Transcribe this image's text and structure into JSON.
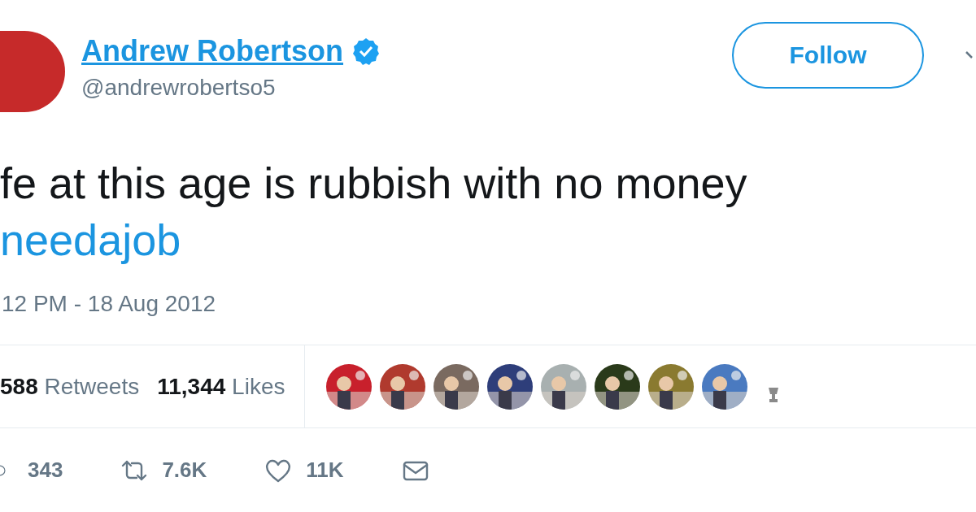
{
  "author": {
    "name": "Andrew Robertson",
    "verified": true,
    "handle": "@andrewrobertso5"
  },
  "follow_button": {
    "label": "Follow"
  },
  "tweet": {
    "lines": [
      "fe at this age is rubbish with no money"
    ],
    "hashtag": "needajob",
    "timestamp": "12 PM - 18 Aug 2012"
  },
  "stats": [
    {
      "count": "588",
      "label": "Retweets"
    },
    {
      "count": "11,344",
      "label": "Likes"
    }
  ],
  "likers": [
    {
      "kind": "picture"
    },
    {
      "kind": "picture"
    },
    {
      "kind": "picture"
    },
    {
      "kind": "picture"
    },
    {
      "kind": "picture"
    },
    {
      "kind": "picture"
    },
    {
      "kind": "picture"
    },
    {
      "kind": "picture"
    },
    {
      "kind": "small"
    }
  ],
  "actions": [
    {
      "kind": "reply",
      "count": "343"
    },
    {
      "kind": "retweet",
      "count": "7.6K"
    },
    {
      "kind": "like",
      "count": "11K"
    },
    {
      "kind": "message"
    }
  ]
}
